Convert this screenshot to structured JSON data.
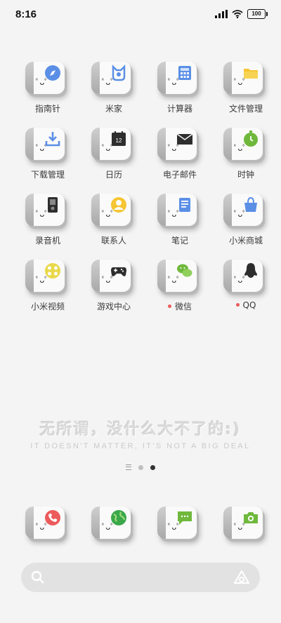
{
  "status_bar": {
    "time": "8:16",
    "battery": "100"
  },
  "apps": [
    {
      "name": "compass-icon",
      "label": "指南针",
      "color": "#5b8fe6",
      "dot": false
    },
    {
      "name": "mijia-icon",
      "label": "米家",
      "color": "#5b8fe6",
      "dot": false
    },
    {
      "name": "calculator-icon",
      "label": "计算器",
      "color": "#5b8fe6",
      "dot": false
    },
    {
      "name": "folder-icon",
      "label": "文件管理",
      "color": "#f5c533",
      "dot": false
    },
    {
      "name": "download-icon",
      "label": "下载管理",
      "color": "#5b8fe6",
      "dot": false
    },
    {
      "name": "calendar-icon",
      "label": "日历",
      "color": "#333333",
      "dot": false,
      "day": "12"
    },
    {
      "name": "mail-icon",
      "label": "电子邮件",
      "color": "#333333",
      "dot": false
    },
    {
      "name": "clock-icon",
      "label": "时钟",
      "color": "#6fb83c",
      "dot": false
    },
    {
      "name": "recorder-icon",
      "label": "录音机",
      "color": "#333333",
      "dot": false
    },
    {
      "name": "contacts-icon",
      "label": "联系人",
      "color": "#f5c533",
      "dot": false
    },
    {
      "name": "notes-icon",
      "label": "笔记",
      "color": "#5b8fe6",
      "dot": false
    },
    {
      "name": "mi-store-icon",
      "label": "小米商城",
      "color": "#5b8fe6",
      "dot": false
    },
    {
      "name": "mi-video-icon",
      "label": "小米视频",
      "color": "#e9d84a",
      "dot": false
    },
    {
      "name": "game-center-icon",
      "label": "游戏中心",
      "color": "#333333",
      "dot": false
    },
    {
      "name": "wechat-icon",
      "label": "微信",
      "color": "#6fb83c",
      "dot": true
    },
    {
      "name": "qq-icon",
      "label": "QQ",
      "color": "#333333",
      "dot": true
    }
  ],
  "slogan": {
    "cn": "无所谓，没什么大不了的:)",
    "en": "IT DOESN'T MATTER, IT'S NOT A BIG DEAL"
  },
  "dock": [
    {
      "name": "phone-icon",
      "color": "#ec5b5b"
    },
    {
      "name": "browser-icon",
      "color": "#3aa84a"
    },
    {
      "name": "messages-icon",
      "color": "#6fb83c"
    },
    {
      "name": "camera-icon",
      "color": "#6fb83c"
    }
  ],
  "search": {
    "placeholder": ""
  }
}
